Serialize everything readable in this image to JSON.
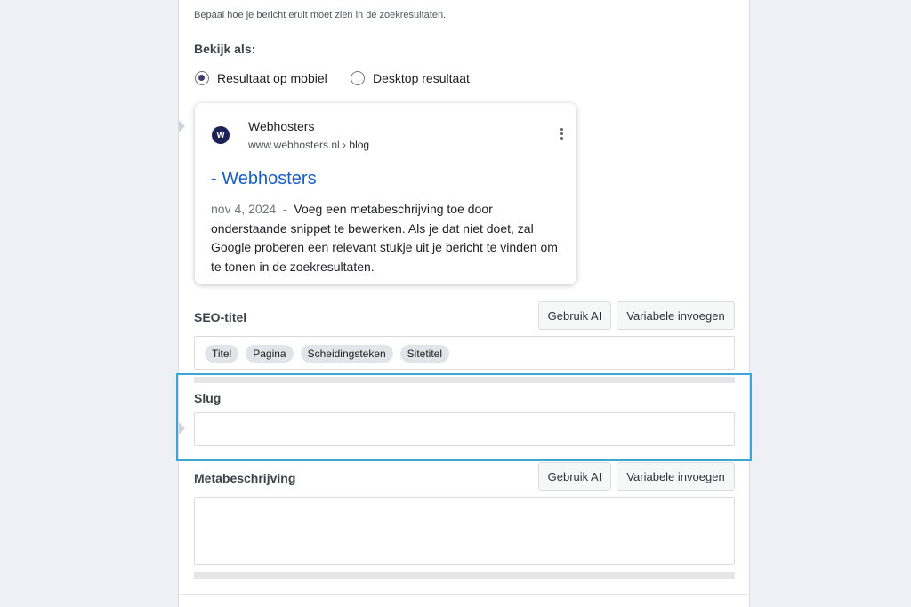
{
  "snippet_editor": {
    "intro": "Bepaal hoe je bericht eruit moet zien in de zoekresultaten.",
    "view_as_label": "Bekijk als:",
    "view_options": [
      {
        "label": "Resultaat op mobiel",
        "selected": true
      },
      {
        "label": "Desktop resultaat",
        "selected": false
      }
    ]
  },
  "preview": {
    "logo_letter": "w",
    "site_name": "Webhosters",
    "url": "www.webhosters.nl",
    "crumb_separator": " › ",
    "breadcrumb": "blog",
    "title": "- Webhosters",
    "date": "nov 4, 2024",
    "date_separator": "  -  ",
    "description": "Voeg een metabeschrijving toe door onderstaande snippet te bewerken. Als je dat niet doet, zal Google proberen een relevant stukje uit je bericht te vinden om te tonen in de zoekresultaten."
  },
  "seo_title": {
    "label": "SEO-titel",
    "use_ai_button": "Gebruik AI",
    "insert_variable_button": "Variabele invoegen",
    "tags": [
      "Titel",
      "Pagina",
      "Scheidingsteken",
      "Sitetitel"
    ]
  },
  "slug": {
    "label": "Slug",
    "value": ""
  },
  "meta_description": {
    "label": "Metabeschrijving",
    "use_ai_button": "Gebruik AI",
    "insert_variable_button": "Variabele invoegen",
    "value": ""
  },
  "colors": {
    "page_background": "#eef0f6",
    "link_blue": "#1a5fc2",
    "highlight_border": "#3aa6d6",
    "logo_background": "#1a2258"
  }
}
